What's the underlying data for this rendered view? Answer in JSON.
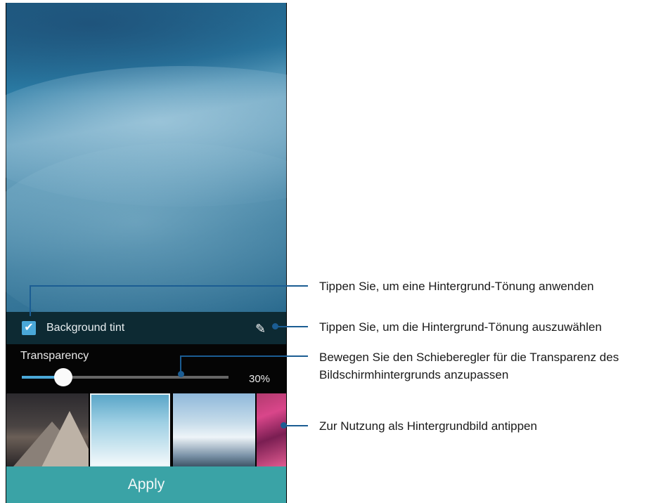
{
  "screen": {
    "background_tint": {
      "checked": true,
      "label": "Background tint",
      "edit_icon": "pencil-icon"
    },
    "transparency": {
      "label": "Transparency",
      "value_percent": 30,
      "value_text": "30%"
    },
    "wallpaper_thumbnails": [
      {
        "subject": "mountain peaks at dusk",
        "selected": false
      },
      {
        "subject": "blue dunes",
        "selected": true
      },
      {
        "subject": "snowy mountain sky",
        "selected": false
      },
      {
        "subject": "pink abstract",
        "selected": false
      }
    ],
    "apply_label": "Apply"
  },
  "annotations": [
    {
      "text": "Tippen Sie, um eine Hintergrund-Tönung anwenden"
    },
    {
      "text": "Tippen Sie, um die Hintergrund-Tönung auszuwählen"
    },
    {
      "lines": [
        "Bewegen Sie den Schieberegler für die Transparenz des",
        "Bildschirmhintergrunds anzupassen"
      ]
    },
    {
      "text": "Zur Nutzung als Hintergrundbild antippen"
    }
  ],
  "colors": {
    "accent": "#4aa8d8",
    "apply_bg": "#3aa3a6",
    "annotation_line": "#1b5d93"
  }
}
